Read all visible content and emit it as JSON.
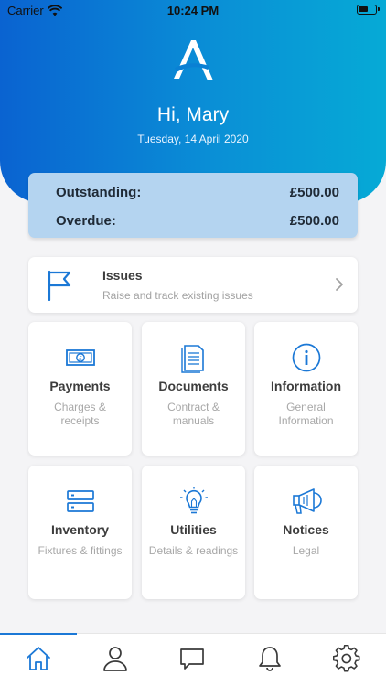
{
  "status_bar": {
    "carrier": "Carrier",
    "time": "10:24 PM"
  },
  "header": {
    "greeting": "Hi, Mary",
    "date": "Tuesday, 14 April 2020"
  },
  "balance": {
    "outstanding_label": "Outstanding:",
    "outstanding_value": "£500.00",
    "overdue_label": "Overdue:",
    "overdue_value": "£500.00"
  },
  "issues": {
    "title": "Issues",
    "subtitle": "Raise and track existing issues"
  },
  "tiles": [
    {
      "title": "Payments",
      "subtitle": "Charges & receipts",
      "icon": "banknote-icon"
    },
    {
      "title": "Documents",
      "subtitle": "Contract & manuals",
      "icon": "document-icon"
    },
    {
      "title": "Information",
      "subtitle": "General Information",
      "icon": "info-icon"
    },
    {
      "title": "Inventory",
      "subtitle": "Fixtures & fittings",
      "icon": "inventory-icon"
    },
    {
      "title": "Utilities",
      "subtitle": "Details & readings",
      "icon": "lightbulb-icon"
    },
    {
      "title": "Notices",
      "subtitle": "Legal",
      "icon": "megaphone-icon"
    }
  ],
  "tabbar": {
    "items": [
      "home-icon",
      "profile-icon",
      "chat-icon",
      "bell-icon",
      "gear-icon"
    ],
    "active": "home-icon"
  },
  "colors": {
    "accent": "#1b78d6",
    "header_start": "#0a63d1",
    "header_end": "#06aad6",
    "balance_bg": "#b4d4f0"
  }
}
